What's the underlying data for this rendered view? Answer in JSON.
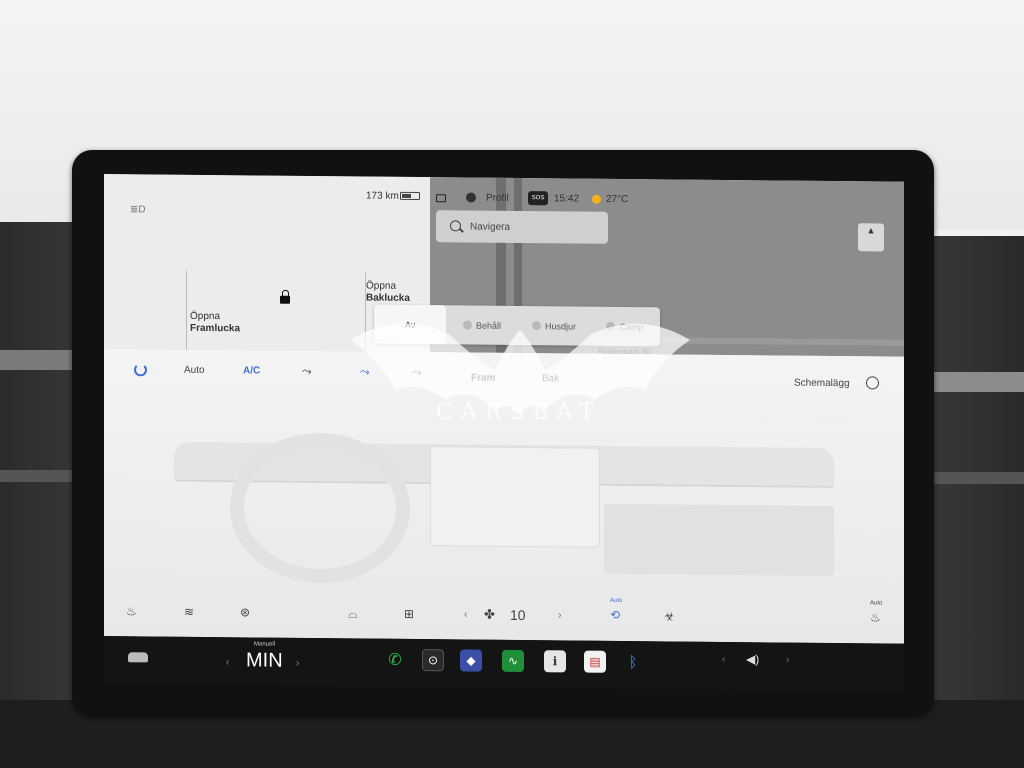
{
  "status": {
    "range": "173 km",
    "profile": "Profil",
    "sos": "SOS",
    "time": "15:42",
    "temperature": "27°C"
  },
  "car": {
    "frunk": "Öppna",
    "frunk_sub": "Framlucka",
    "trunk": "Öppna",
    "trunk_sub": "Baklucka"
  },
  "map": {
    "search_placeholder": "Navigera",
    "place_label": "Riddermark Bil"
  },
  "modes": [
    {
      "label": "Av",
      "active": true
    },
    {
      "label": "Behåll",
      "active": false
    },
    {
      "label": "Husdjur",
      "active": false
    },
    {
      "label": "Camp",
      "active": false
    }
  ],
  "climate": {
    "auto": "Auto",
    "ac": "A/C",
    "front": "Fram",
    "rear": "Bak",
    "schedule": "Schemalägg",
    "fan_level": "10",
    "recirc_label": "Auto",
    "right_seat_label": "Auto"
  },
  "taskbar": {
    "mode_label": "Manuell",
    "temp": "MIN"
  },
  "watermark": "CARSBAT",
  "colors": {
    "accent_blue": "#3e6fd8",
    "phone_green": "#2fc14a",
    "taskbar_bg": "#141414"
  },
  "icons": [
    "car-icon",
    "phone-icon",
    "camera-icon",
    "game-icon",
    "stocks-icon",
    "notes-icon",
    "calendar-icon",
    "bluetooth-icon",
    "volume-icon",
    "power-icon",
    "fan-icon",
    "seat-heat-icon",
    "defrost-icon",
    "steering-heat-icon",
    "recirculate-icon",
    "bioweapon-icon",
    "clock-icon"
  ]
}
